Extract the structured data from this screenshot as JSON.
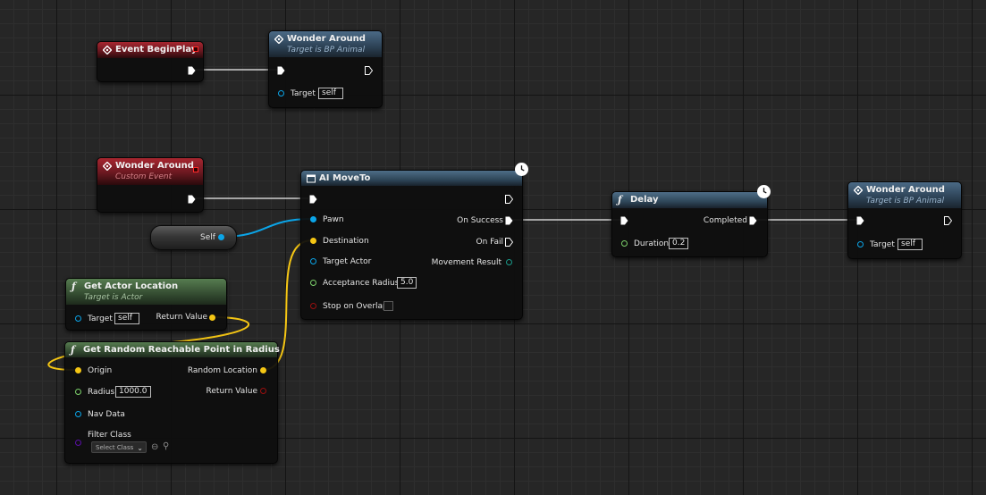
{
  "colors": {
    "exec": "#ffffff",
    "object": "#0ba5e8",
    "vector": "#f5c614",
    "float": "#7dd16b",
    "bool": "#9b0f0f",
    "class": "#5a0fa8",
    "wire": "#cfcfcf"
  },
  "icons": {
    "event": "event-diamond-icon",
    "function": "function-f-icon",
    "macro": "ai-move-to-icon",
    "latent": "clock-icon",
    "reset": "reset-arrow-icon",
    "browse": "search-icon"
  },
  "nodes": {
    "event_begin_play": {
      "title": "Event BeginPlay"
    },
    "wonder_around_call_1": {
      "title": "Wonder Around",
      "subtitle": "Target is BP Animal",
      "target_label": "Target",
      "target_value": "self"
    },
    "custom_event": {
      "title": "Wonder Around",
      "subtitle": "Custom Event"
    },
    "self_node": {
      "label": "Self"
    },
    "ai_move_to": {
      "title": "AI MoveTo",
      "pawn_label": "Pawn",
      "destination_label": "Destination",
      "target_actor_label": "Target Actor",
      "acceptance_radius_label": "Acceptance Radius",
      "acceptance_radius_value": "5.0",
      "stop_on_overlap_label": "Stop on Overlap",
      "on_success_label": "On Success",
      "on_fail_label": "On Fail",
      "movement_result_label": "Movement Result"
    },
    "delay": {
      "title": "Delay",
      "duration_label": "Duration",
      "duration_value": "0.2",
      "completed_label": "Completed"
    },
    "wonder_around_call_2": {
      "title": "Wonder Around",
      "subtitle": "Target is BP Animal",
      "target_label": "Target",
      "target_value": "self"
    },
    "get_actor_location": {
      "title": "Get Actor Location",
      "subtitle": "Target is Actor",
      "target_label": "Target",
      "target_value": "self",
      "return_label": "Return Value"
    },
    "get_random_point": {
      "title": "Get Random Reachable Point in Radius",
      "origin_label": "Origin",
      "radius_label": "Radius",
      "radius_value": "1000.0",
      "nav_data_label": "Nav Data",
      "filter_class_label": "Filter Class",
      "filter_class_value": "Select Class",
      "random_location_label": "Random Location",
      "return_label": "Return Value"
    }
  }
}
